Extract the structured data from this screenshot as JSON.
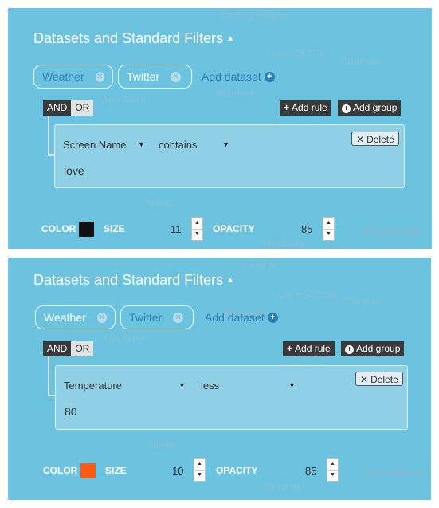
{
  "panels": [
    {
      "title": "Datasets and Standard Filters",
      "datasets": [
        {
          "label": "Weather",
          "state": "inactive"
        },
        {
          "label": "Twitter",
          "state": "active"
        }
      ],
      "add_dataset_label": "Add dataset",
      "conjunction": {
        "and": "AND",
        "or": "OR",
        "selected": "AND"
      },
      "add_rule_label": "Add rule",
      "add_group_label": "Add group",
      "rule": {
        "field": "Screen Name",
        "operator": "contains",
        "value": "love"
      },
      "delete_label": "Delete",
      "color_label": "COLOR",
      "color_value": "#111111",
      "size_label": "SIZE",
      "size_value": "11",
      "opacity_label": "OPACITY",
      "opacity_value": "85"
    },
    {
      "title": "Datasets and Standard Filters",
      "datasets": [
        {
          "label": "Weather",
          "state": "active"
        },
        {
          "label": "Twitter",
          "state": "inactive"
        }
      ],
      "add_dataset_label": "Add dataset",
      "conjunction": {
        "and": "AND",
        "or": "OR",
        "selected": "AND"
      },
      "add_rule_label": "Add rule",
      "add_group_label": "Add group",
      "rule": {
        "field": "Temperature",
        "operator": "less",
        "value": "80"
      },
      "delete_label": "Delete",
      "color_label": "COLOR",
      "color_value": "#ff5a14",
      "size_label": "SIZE",
      "size_value": "10",
      "opacity_label": "OPACITY",
      "opacity_value": "85"
    }
  ],
  "map_labels": {
    "p1": [
      "Sterling Heights",
      "Lake St Clair",
      "Chatham",
      "Ann Arbor",
      "Windsor",
      "Leamington",
      "Toledo",
      "Sandusky",
      "Cleveland",
      "Adrian"
    ],
    "p2": [
      "Heights",
      "Detroit",
      "Lake St Clair",
      "Chatham",
      "Ann Arbor",
      "Leamington",
      "Toledo",
      "Sandusky",
      "Cleveland",
      "Adrian"
    ]
  },
  "theme": {
    "panel_bg": "#6cc3e0",
    "link": "#2c7fb3",
    "dark": "#3a3a3a"
  }
}
